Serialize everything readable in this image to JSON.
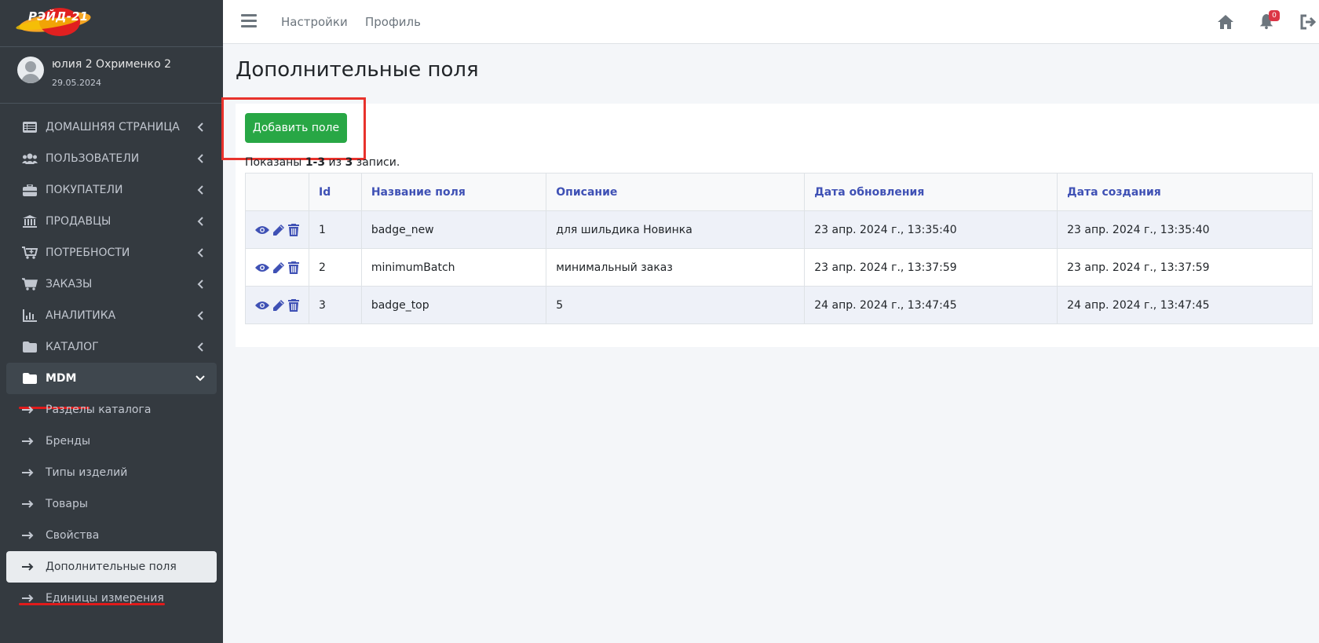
{
  "app": {
    "logo_text": "РЭЙД-21",
    "colors": {
      "sidebar": "#343a40",
      "accent": "#28a745",
      "link": "#3f51b5",
      "highlight": "#e8322c"
    }
  },
  "user": {
    "name": "юлия 2 Охрименко 2",
    "date": "29.05.2024"
  },
  "sidebar": {
    "items": [
      {
        "label": "ДОМАШНЯЯ СТРАНИЦА",
        "icon": "list-icon"
      },
      {
        "label": "ПОЛЬЗОВАТЕЛИ",
        "icon": "users-icon"
      },
      {
        "label": "ПОКУПАТЕЛИ",
        "icon": "briefcase-icon"
      },
      {
        "label": "ПРОДАВЦЫ",
        "icon": "bank-icon"
      },
      {
        "label": "ПОТРЕБНОСТИ",
        "icon": "cart-plus-icon"
      },
      {
        "label": "ЗАКАЗЫ",
        "icon": "cart-icon"
      },
      {
        "label": "АНАЛИТИКА",
        "icon": "chart-icon"
      },
      {
        "label": "КАТАЛОГ",
        "icon": "folder-icon"
      },
      {
        "label": "MDM",
        "icon": "folder-icon"
      }
    ],
    "subitems": [
      {
        "label": "Разделы каталога"
      },
      {
        "label": "Бренды"
      },
      {
        "label": "Типы изделий"
      },
      {
        "label": "Товары"
      },
      {
        "label": "Свойства"
      },
      {
        "label": "Дополнительные поля"
      },
      {
        "label": "Единицы измерения"
      }
    ]
  },
  "topbar": {
    "links": [
      "Настройки",
      "Профиль"
    ],
    "notifications_count": "0"
  },
  "page": {
    "title": "Дополнительные поля",
    "add_button": "Добавить поле",
    "summary_prefix": "Показаны ",
    "summary_range": "1-3",
    "summary_mid": " из ",
    "summary_total": "3",
    "summary_suffix": " записи."
  },
  "table": {
    "headers": [
      "",
      "Id",
      "Название поля",
      "Описание",
      "Дата обновления",
      "Дата создания"
    ],
    "rows": [
      {
        "id": "1",
        "name": "badge_new",
        "description": "для шильдика Новинка",
        "updated": "23 апр. 2024 г., 13:35:40",
        "created": "23 апр. 2024 г., 13:35:40"
      },
      {
        "id": "2",
        "name": "minimumBatch",
        "description": "минимальный заказ",
        "updated": "23 апр. 2024 г., 13:37:59",
        "created": "23 апр. 2024 г., 13:37:59"
      },
      {
        "id": "3",
        "name": "badge_top",
        "description": "5",
        "updated": "24 апр. 2024 г., 13:47:45",
        "created": "24 апр. 2024 г., 13:47:45"
      }
    ]
  }
}
